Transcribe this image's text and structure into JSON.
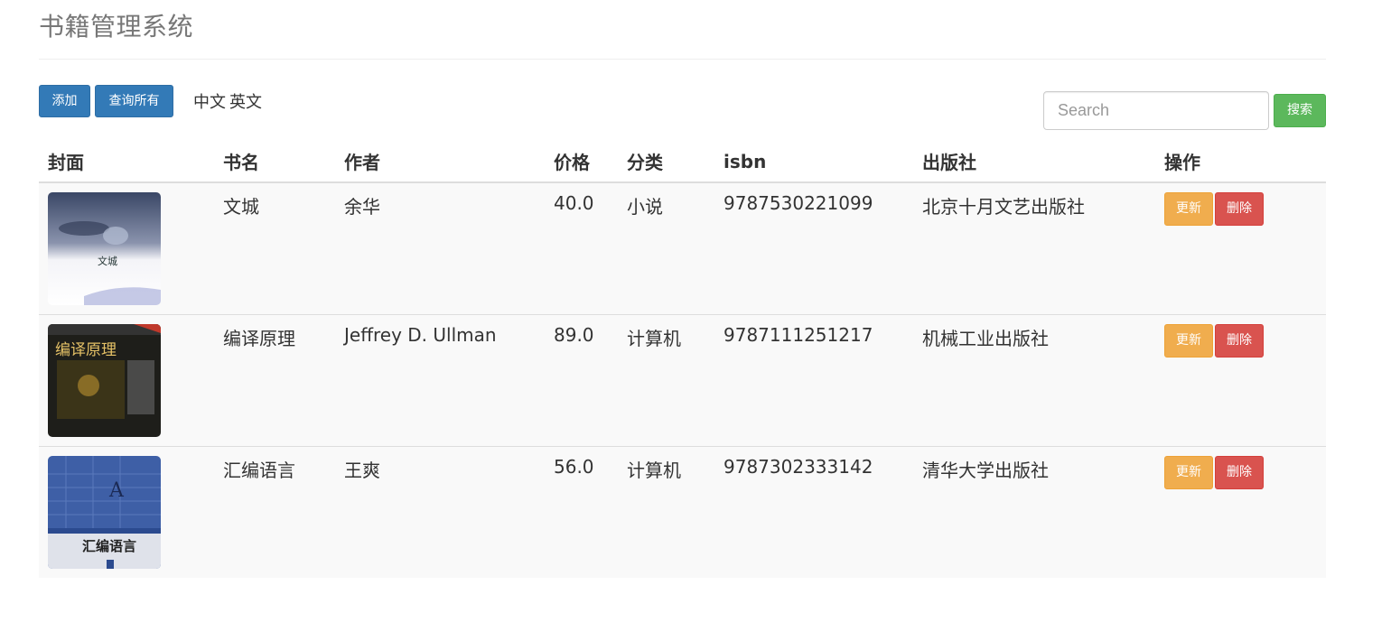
{
  "header": {
    "title": "书籍管理系统"
  },
  "toolbar": {
    "add_label": "添加",
    "query_all_label": "查询所有",
    "lang_zh": "中文",
    "lang_en": "英文",
    "search_placeholder": "Search",
    "search_label": "搜索"
  },
  "table": {
    "columns": [
      "封面",
      "书名",
      "作者",
      "价格",
      "分类",
      "isbn",
      "出版社",
      "操作"
    ],
    "rows": [
      {
        "name": "文城",
        "author": "余华",
        "price": "40.0",
        "category": "小说",
        "isbn": "9787530221099",
        "publisher": "北京十月文艺出版社",
        "cover_text": "文城"
      },
      {
        "name": "编译原理",
        "author": "Jeffrey D. Ullman",
        "price": "89.0",
        "category": "计算机",
        "isbn": "9787111251217",
        "publisher": "机械工业出版社",
        "cover_text": "编译原理"
      },
      {
        "name": "汇编语言",
        "author": "王爽",
        "price": "56.0",
        "category": "计算机",
        "isbn": "9787302333142",
        "publisher": "清华大学出版社",
        "cover_text": "汇编语言"
      }
    ],
    "update_label": "更新",
    "delete_label": "删除"
  }
}
